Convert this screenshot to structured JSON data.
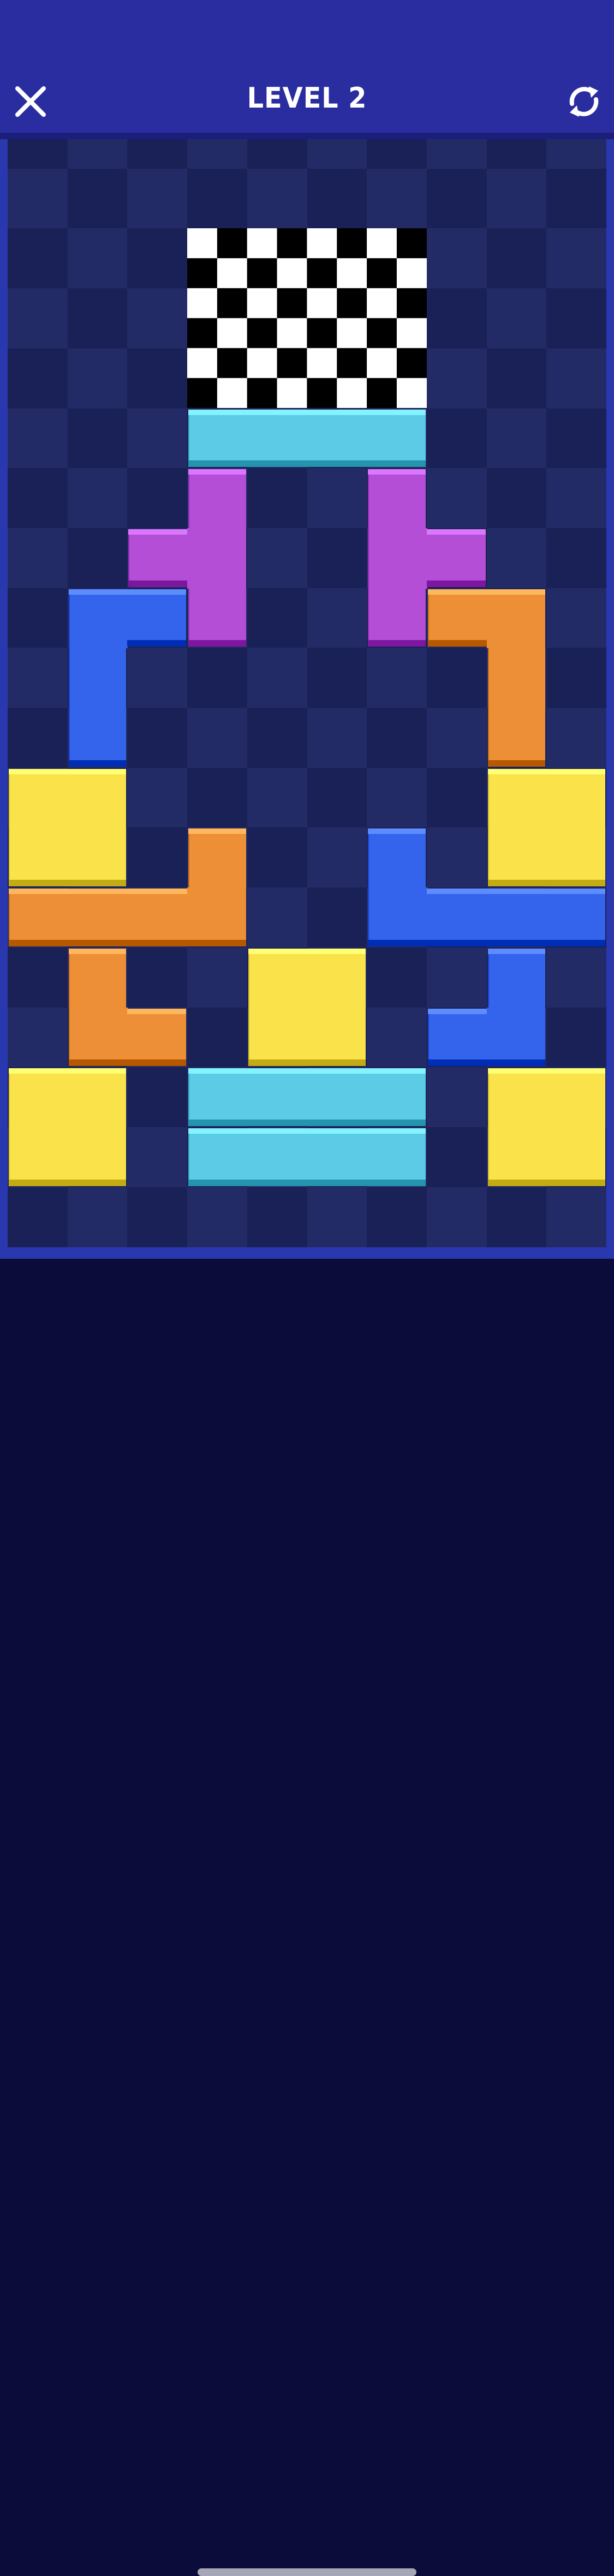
{
  "header": {
    "title": "LEVEL 2",
    "close_icon": "close-icon",
    "refresh_icon": "refresh-icon"
  },
  "board": {
    "columns": 10,
    "rows": 19,
    "goal": "finish-flag-checkered",
    "pieces": [
      {
        "name": "cyan-bar-top",
        "color": "cyan"
      },
      {
        "name": "purple-t-left",
        "color": "purple"
      },
      {
        "name": "purple-t-right",
        "color": "purple"
      },
      {
        "name": "blue-l-left",
        "color": "blue"
      },
      {
        "name": "orange-l-right",
        "color": "orange"
      },
      {
        "name": "yellow-square-left-top",
        "color": "yellow"
      },
      {
        "name": "yellow-square-right-top",
        "color": "yellow"
      },
      {
        "name": "orange-l-long-left",
        "color": "orange"
      },
      {
        "name": "blue-l-long-right",
        "color": "blue"
      },
      {
        "name": "orange-l-small",
        "color": "orange"
      },
      {
        "name": "yellow-square-center",
        "color": "yellow"
      },
      {
        "name": "blue-j-small",
        "color": "blue"
      },
      {
        "name": "yellow-square-left-bottom",
        "color": "yellow"
      },
      {
        "name": "cyan-bar-bottom-1",
        "color": "cyan"
      },
      {
        "name": "cyan-bar-bottom-2",
        "color": "cyan"
      },
      {
        "name": "yellow-square-right-bottom",
        "color": "yellow"
      }
    ]
  },
  "colors": {
    "header_bg": "#2a2d9f",
    "board_border": "#2a38b0",
    "grid_dark": "#1a2156",
    "grid_light": "#232b66",
    "cyan": "#5ccbe6",
    "purple": "#b54ed6",
    "blue": "#3564ec",
    "orange": "#ec8f36",
    "yellow": "#f9e24a"
  }
}
